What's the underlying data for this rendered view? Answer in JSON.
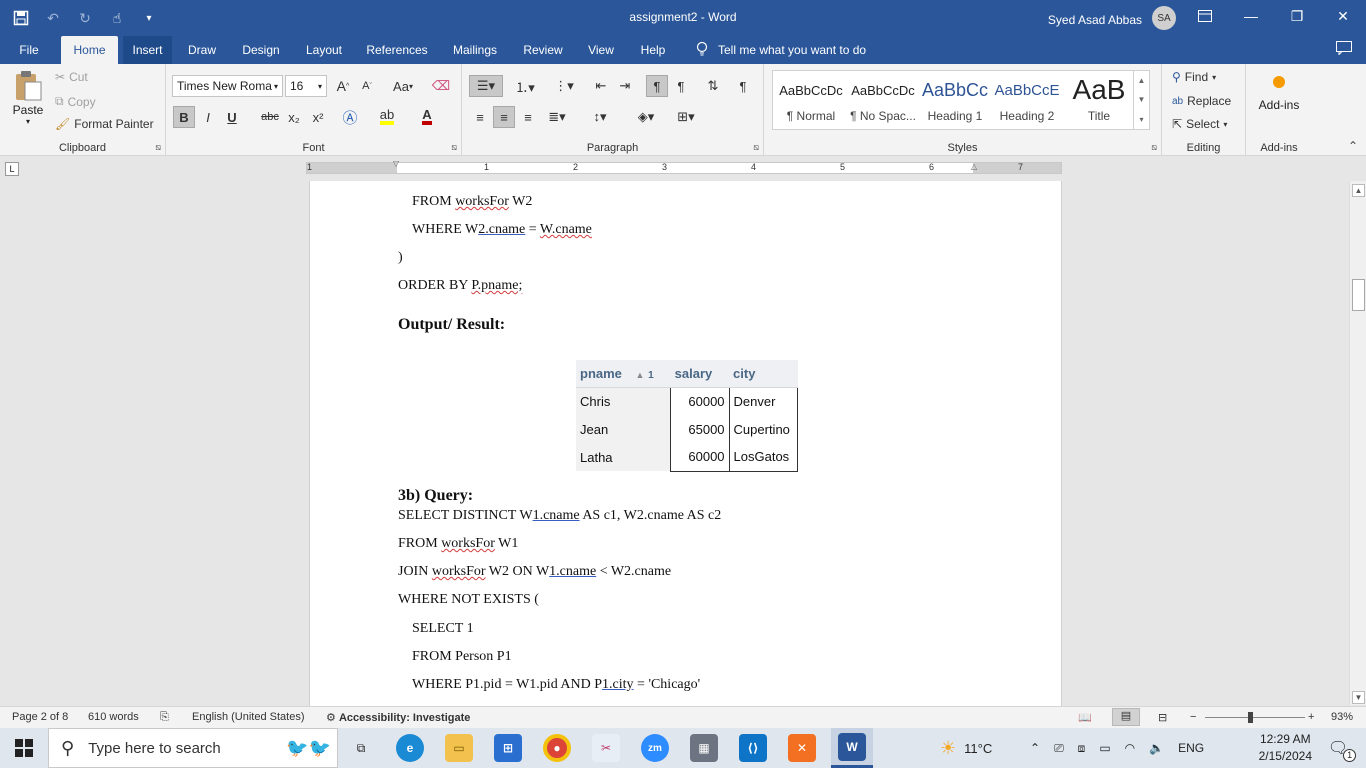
{
  "titlebar": {
    "doc_title": "assignment2  -  Word",
    "user_name": "Syed Asad Abbas",
    "user_initials": "SA",
    "qat": [
      "save-icon",
      "undo-icon",
      "redo-icon",
      "touch-mode-icon",
      "customize-qat-icon"
    ]
  },
  "tabs": {
    "file": "File",
    "items": [
      "Home",
      "Insert",
      "Draw",
      "Design",
      "Layout",
      "References",
      "Mailings",
      "Review",
      "View",
      "Help"
    ],
    "active": "Home",
    "tell_me": "Tell me what you want to do"
  },
  "ribbon": {
    "clipboard": {
      "paste": "Paste",
      "cut": "Cut",
      "copy": "Copy",
      "format_painter": "Format Painter",
      "label": "Clipboard"
    },
    "font": {
      "family": "Times New Roma",
      "size": "16",
      "label": "Font",
      "bold": "B",
      "italic": "I",
      "underline": "U",
      "strike": "abc",
      "subscript": "x₂",
      "superscript": "x²",
      "change_case": "Aa",
      "grow": "A",
      "shrink": "A"
    },
    "paragraph": {
      "label": "Paragraph"
    },
    "styles": {
      "label": "Styles",
      "items": [
        {
          "sample": "AaBbCcDc",
          "name": "¶ Normal"
        },
        {
          "sample": "AaBbCcDc",
          "name": "¶ No Spac..."
        },
        {
          "sample": "AaBbCc",
          "name": "Heading 1"
        },
        {
          "sample": "AaBbCcE",
          "name": "Heading 2"
        },
        {
          "sample": "AaB",
          "name": "Title"
        }
      ]
    },
    "editing": {
      "find": "Find",
      "replace": "Replace",
      "select": "Select",
      "label": "Editing"
    },
    "addins": {
      "button": "Add-ins",
      "label": "Add-ins"
    }
  },
  "ruler": {
    "numbers": [
      "1",
      "1",
      "2",
      "3",
      "4",
      "5",
      "6",
      "7"
    ]
  },
  "document": {
    "lines": {
      "l1": "FROM worksFor W2",
      "l2": "WHERE W2.cname = W.cname",
      "l3": ")",
      "l4": "ORDER BY P.pname;",
      "h1": "Output/ Result:",
      "h2": "3b) Query:",
      "l5": "SELECT DISTINCT W1.cname AS c1, W2.cname AS c2",
      "l6": "FROM worksFor W1",
      "l7": "JOIN worksFor W2 ON W1.cname < W2.cname",
      "l8": "WHERE NOT EXISTS (",
      "l9": "SELECT 1",
      "l10": "FROM Person P1",
      "l11": "WHERE P1.pid = W1.pid AND P1.city = 'Chicago'"
    },
    "result_table": {
      "headers": [
        "pname",
        "salary",
        "city"
      ],
      "sort_indicator": "1",
      "rows": [
        [
          "Chris",
          "60000",
          "Denver"
        ],
        [
          "Jean",
          "65000",
          "Cupertino"
        ],
        [
          "Latha",
          "60000",
          "LosGatos"
        ]
      ]
    }
  },
  "status": {
    "page": "Page 2 of 8",
    "words": "610 words",
    "language": "English (United States)",
    "accessibility": "Accessibility: Investigate",
    "zoom": "93%"
  },
  "taskbar": {
    "search_placeholder": "Type here to search",
    "weather": "11°C",
    "lang": "ENG",
    "time": "12:29 AM",
    "date": "2/15/2024",
    "notification_count": "1"
  },
  "colors": {
    "accent": "#2b579a",
    "squiggle": "#d23b3b"
  }
}
